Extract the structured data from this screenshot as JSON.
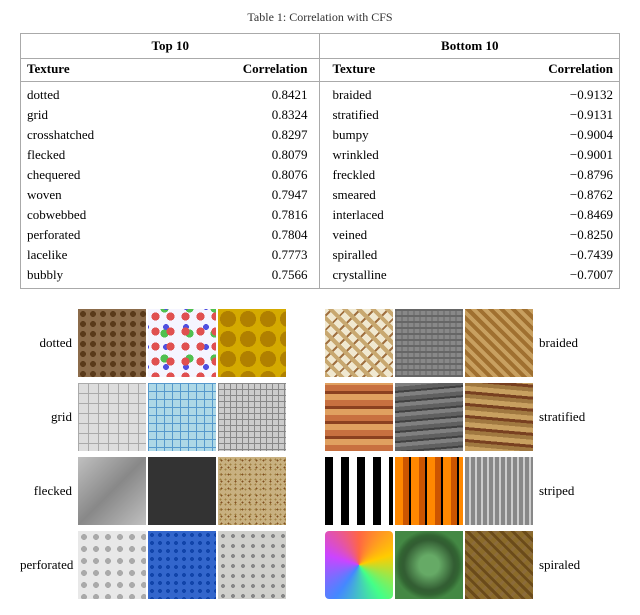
{
  "title": "Table 1: Correlation with CFS",
  "table": {
    "top10_header": "Top 10",
    "bot10_header": "Bottom 10",
    "texture_col": "Texture",
    "correlation_col": "Correlation",
    "top10": [
      {
        "texture": "dotted",
        "corr": "0.8421"
      },
      {
        "texture": "grid",
        "corr": "0.8324"
      },
      {
        "texture": "crosshatched",
        "corr": "0.8297"
      },
      {
        "texture": "flecked",
        "corr": "0.8079"
      },
      {
        "texture": "chequered",
        "corr": "0.8076"
      },
      {
        "texture": "woven",
        "corr": "0.7947"
      },
      {
        "texture": "cobwebbed",
        "corr": "0.7816"
      },
      {
        "texture": "perforated",
        "corr": "0.7804"
      },
      {
        "texture": "lacelike",
        "corr": "0.7773"
      },
      {
        "texture": "bubbly",
        "corr": "0.7566"
      }
    ],
    "bot10": [
      {
        "texture": "braided",
        "corr": "−0.9132"
      },
      {
        "texture": "stratified",
        "corr": "−0.9131"
      },
      {
        "texture": "bumpy",
        "corr": "−0.9004"
      },
      {
        "texture": "wrinkled",
        "corr": "−0.9001"
      },
      {
        "texture": "freckled",
        "corr": "−0.8796"
      },
      {
        "texture": "smeared",
        "corr": "−0.8762"
      },
      {
        "texture": "interlaced",
        "corr": "−0.8469"
      },
      {
        "texture": "veined",
        "corr": "−0.8250"
      },
      {
        "texture": "spiralled",
        "corr": "−0.7439"
      },
      {
        "texture": "crystalline",
        "corr": "−0.7007"
      }
    ]
  },
  "image_rows": {
    "left": [
      {
        "label": "dotted"
      },
      {
        "label": "grid"
      },
      {
        "label": "flecked"
      },
      {
        "label": "perforated"
      }
    ],
    "right": [
      {
        "label": "braided"
      },
      {
        "label": "stratified"
      },
      {
        "label": "striped"
      },
      {
        "label": "spiraled"
      }
    ]
  }
}
